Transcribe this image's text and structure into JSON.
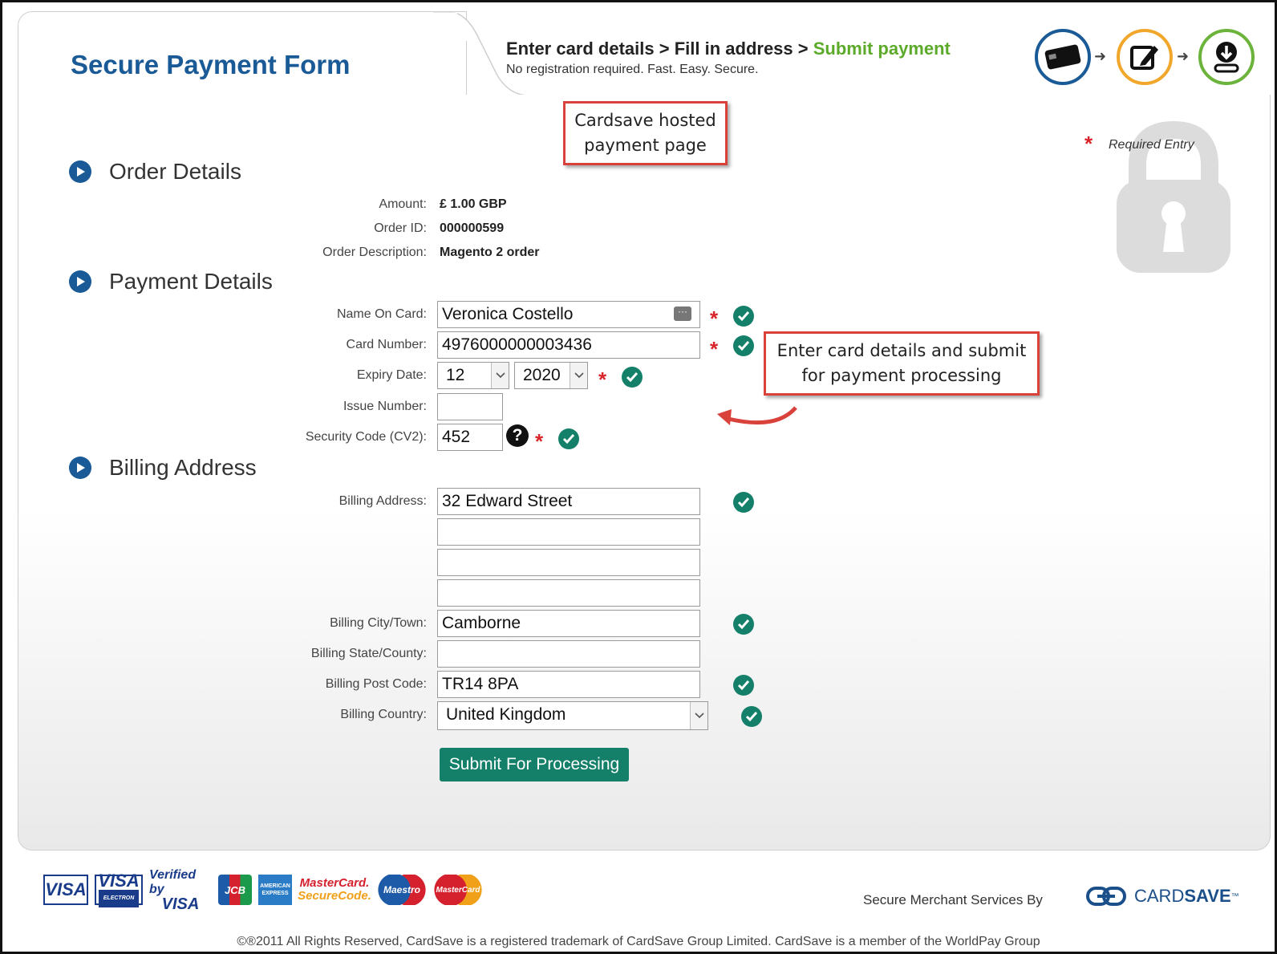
{
  "header": {
    "title": "Secure Payment Form",
    "steps": {
      "step1": "Enter card details",
      "sep1": " > ",
      "step2": "Fill in address",
      "sep2": " > ",
      "step3": "Submit payment"
    },
    "subtitle": "No registration required. Fast. Easy. Secure.",
    "icons": [
      "card-icon",
      "edit-icon",
      "download-icon"
    ]
  },
  "callouts": {
    "hosted": "Cardsave hosted payment page",
    "enter": "Enter card details and submit for payment processing"
  },
  "required_note": {
    "star": "*",
    "text": "Required Entry"
  },
  "order": {
    "section_title": "Order Details",
    "amount_label": "Amount:",
    "amount_value": "£ 1.00 GBP",
    "order_id_label": "Order ID:",
    "order_id_value": "000000599",
    "description_label": "Order Description:",
    "description_value": "Magento 2 order"
  },
  "payment": {
    "section_title": "Payment Details",
    "name_label": "Name On Card:",
    "name_value": "Veronica Costello",
    "card_label": "Card Number:",
    "card_value": "4976000000003436",
    "expiry_label": "Expiry Date:",
    "expiry_month": "12",
    "expiry_year": "2020",
    "issue_label": "Issue Number:",
    "issue_value": "",
    "cv2_label": "Security Code (CV2):",
    "cv2_value": "452",
    "help_glyph": "?"
  },
  "billing": {
    "section_title": "Billing Address",
    "address_label": "Billing Address:",
    "address_line1": "32 Edward Street",
    "address_line2": "",
    "address_line3": "",
    "address_line4": "",
    "city_label": "Billing City/Town:",
    "city_value": "Camborne",
    "state_label": "Billing State/County:",
    "state_value": "",
    "postcode_label": "Billing Post Code:",
    "postcode_value": "TR14 8PA",
    "country_label": "Billing Country:",
    "country_value": "United Kingdom"
  },
  "submit_label": "Submit For Processing",
  "footer": {
    "card_logos": [
      "VISA",
      "VISA",
      "Verified by VISA",
      "JCB",
      "AMEX",
      "MasterCard. SecureCode.",
      "Maestro",
      "MasterCard"
    ],
    "logo_text": {
      "visa": "VISA",
      "visa_electron": "VISA",
      "electron": "ELECTRON",
      "verified_top": "Verified by",
      "verified_bottom": "VISA",
      "jcb": "JCB",
      "amex": "AMERICAN EXPRESS",
      "mc_top": "MasterCard.",
      "mc_bottom": "SecureCode.",
      "maestro": "Maestro",
      "mastercard": "MasterCard"
    },
    "secure_by": "Secure Merchant Services By",
    "brand_light": "CARD",
    "brand_bold": "SAVE",
    "brand_mark": "™",
    "copyright": "©®2011 All Rights Reserved, CardSave is a registered trademark of CardSave Group Limited. CardSave is a member of the WorldPay Group"
  },
  "colors": {
    "title_blue": "#1a5a96",
    "step_green": "#5caa2a",
    "required_red": "#d9242a",
    "check_green": "#14806a",
    "submit_bg": "#14806a",
    "callout_border": "#d9413b"
  }
}
